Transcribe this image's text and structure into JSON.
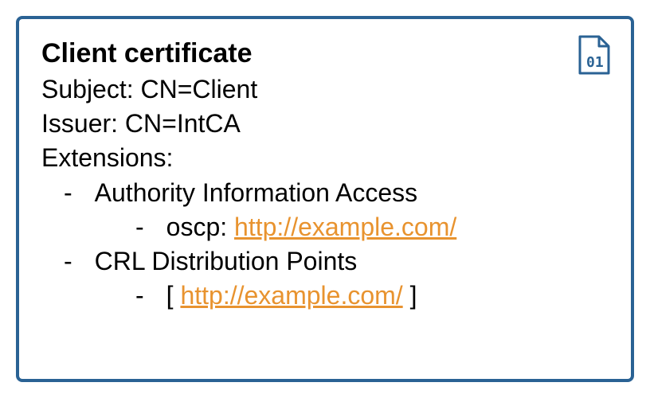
{
  "title": "Client certificate",
  "subject_label": "Subject: ",
  "subject_value": "CN=Client",
  "issuer_label": "Issuer: ",
  "issuer_value": "CN=IntCA",
  "extensions_label": "Extensions:",
  "ext_aia": "Authority Information Access",
  "ext_aia_oscp_label": "oscp: ",
  "ext_aia_oscp_url": "http://example.com/",
  "ext_crl": "CRL Distribution Points",
  "ext_crl_bracket_open": "[ ",
  "ext_crl_url": "http://example.com/",
  "ext_crl_bracket_close": " ]"
}
